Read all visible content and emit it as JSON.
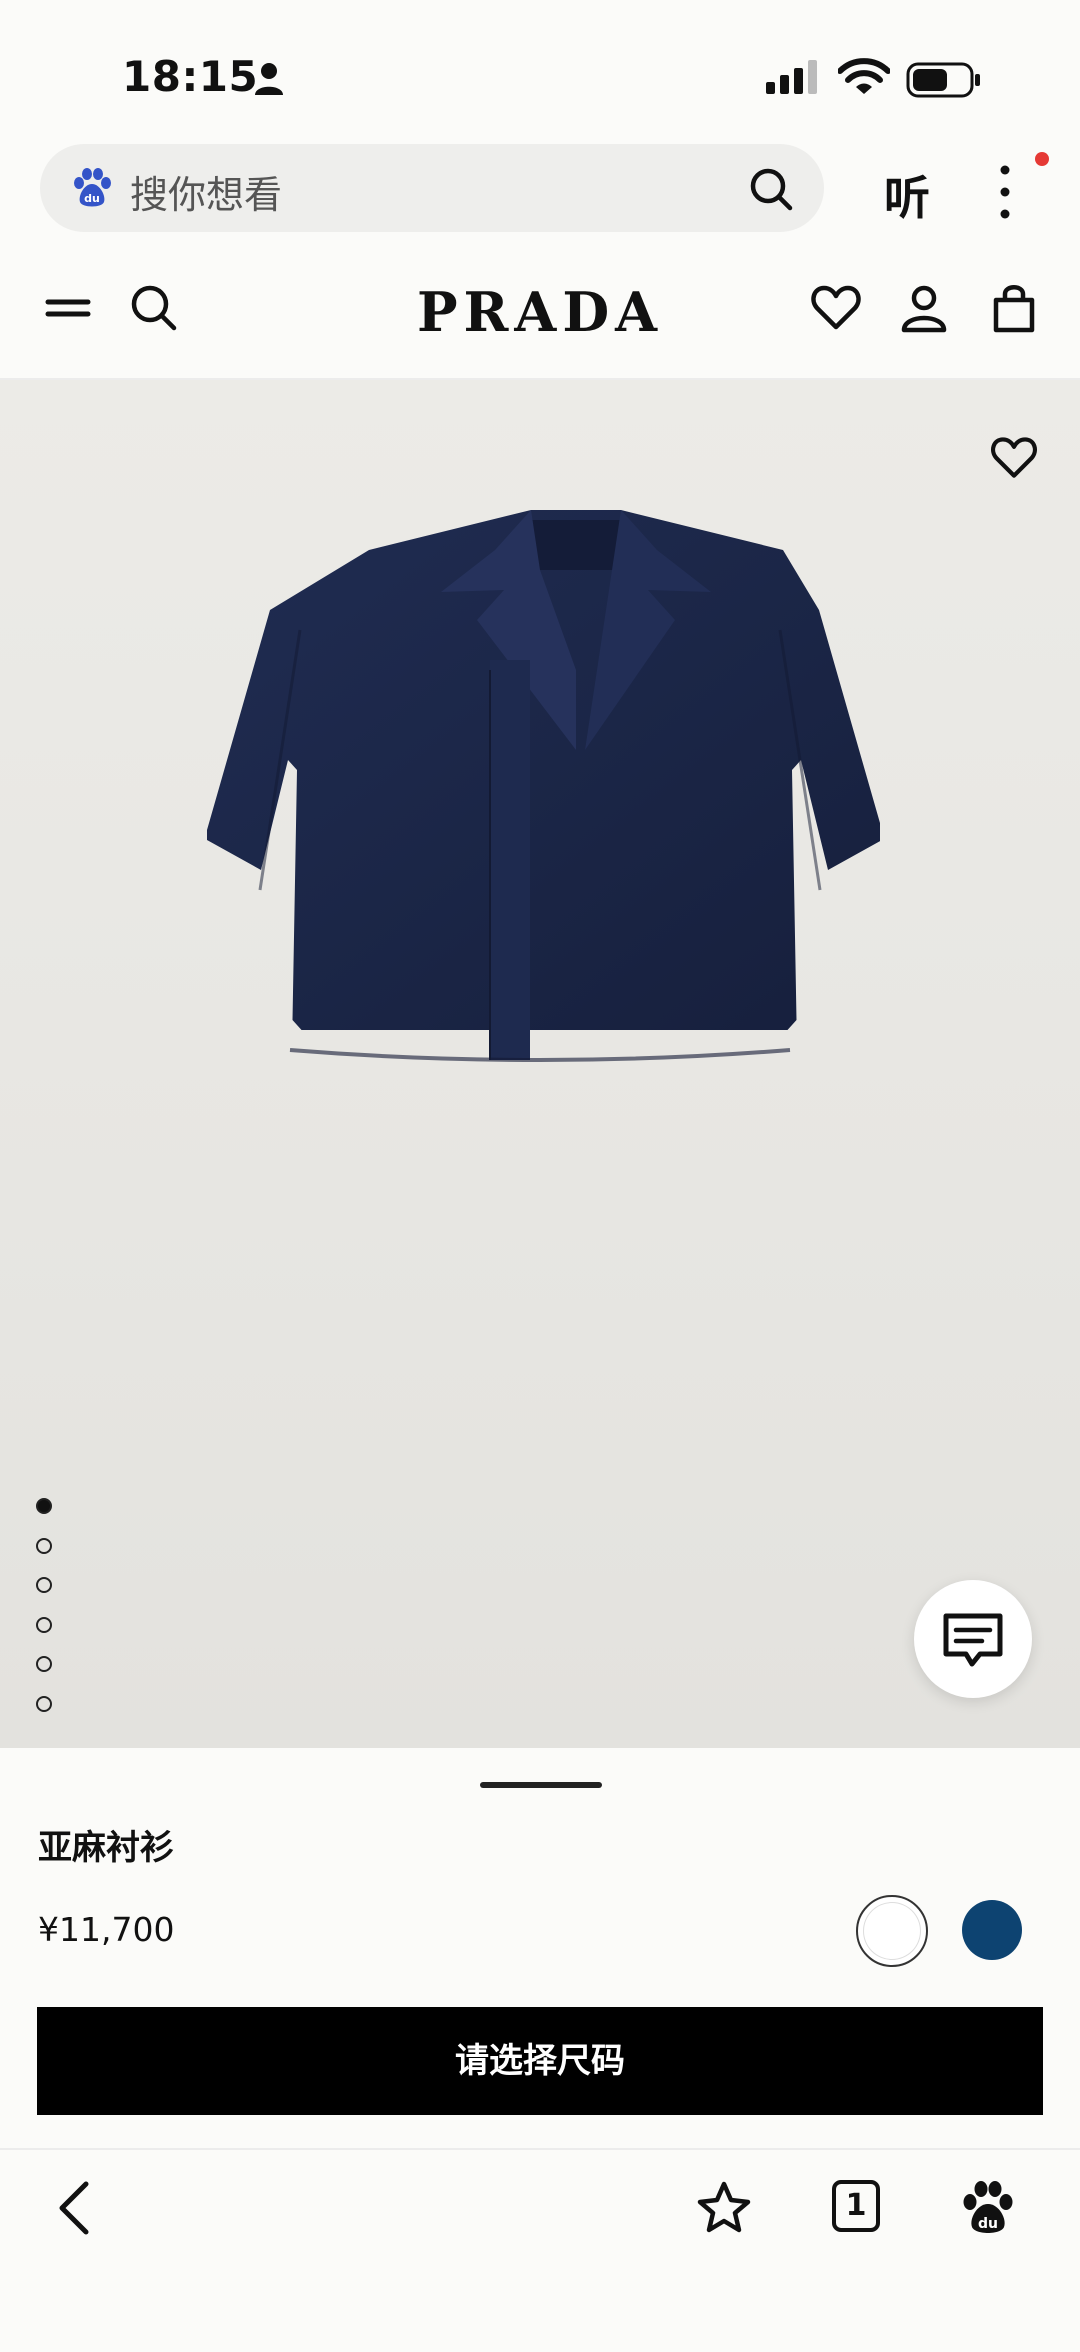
{
  "status_bar": {
    "time": "18:15"
  },
  "browser": {
    "search_placeholder": "搜你想看",
    "listen_label": "听",
    "tab_count": "1"
  },
  "site": {
    "brand": "PRADA"
  },
  "product": {
    "name": "亚麻衬衫",
    "price": "¥11,700",
    "colors": [
      "#ffffff",
      "#0d4371"
    ],
    "image_count": 6,
    "image_index": 1,
    "size_button_label": "请选择尺码"
  },
  "colors": {
    "shirt": "#1c2748",
    "notification": "#e53935"
  }
}
